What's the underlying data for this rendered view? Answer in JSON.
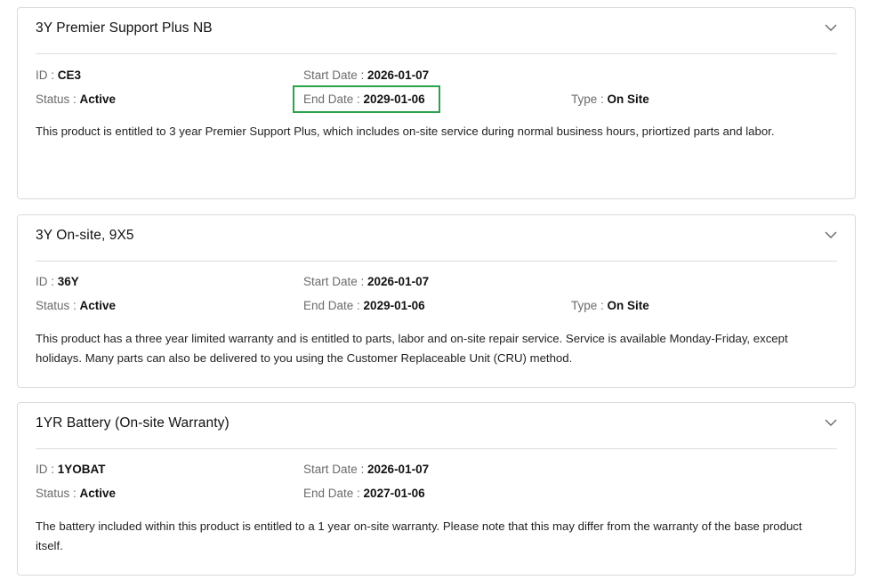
{
  "entitlements": [
    {
      "title": "3Y Premier Support Plus NB",
      "id_label": "ID : ",
      "id": "CE3",
      "status_label": "Status : ",
      "status": "Active",
      "start_label": "Start Date : ",
      "start_date": "2026-01-07",
      "end_label": "End Date : ",
      "end_date": "2029-01-06",
      "type_label": "Type : ",
      "type": "On Site",
      "description": "This product is entitled to 3 year Premier Support Plus, which includes on-site service during normal business hours, priortized parts and labor."
    },
    {
      "title": "3Y On-site, 9X5",
      "id_label": "ID : ",
      "id": "36Y",
      "status_label": "Status : ",
      "status": "Active",
      "start_label": "Start Date : ",
      "start_date": "2026-01-07",
      "end_label": "End Date : ",
      "end_date": "2029-01-06",
      "type_label": "Type : ",
      "type": "On Site",
      "description": "This product has a three year limited warranty and is entitled to parts, labor and on-site repair service. Service is available Monday-Friday, except holidays. Many parts can also be delivered to you using the Customer Replaceable Unit (CRU) method."
    },
    {
      "title": "1YR Battery (On-site Warranty)",
      "id_label": "ID : ",
      "id": "1YOBAT",
      "status_label": "Status : ",
      "status": "Active",
      "start_label": "Start Date : ",
      "start_date": "2026-01-07",
      "end_label": "End Date : ",
      "end_date": "2027-01-06",
      "description": "The battery included within this product is entitled to a 1 year on-site warranty. Please note that this may differ from the warranty of the base product itself."
    }
  ],
  "colors": {
    "highlight": "#2aa34a",
    "border": "#dadada",
    "label": "#6b6b6b"
  },
  "icons": {
    "expand": "chevron-down-icon"
  }
}
